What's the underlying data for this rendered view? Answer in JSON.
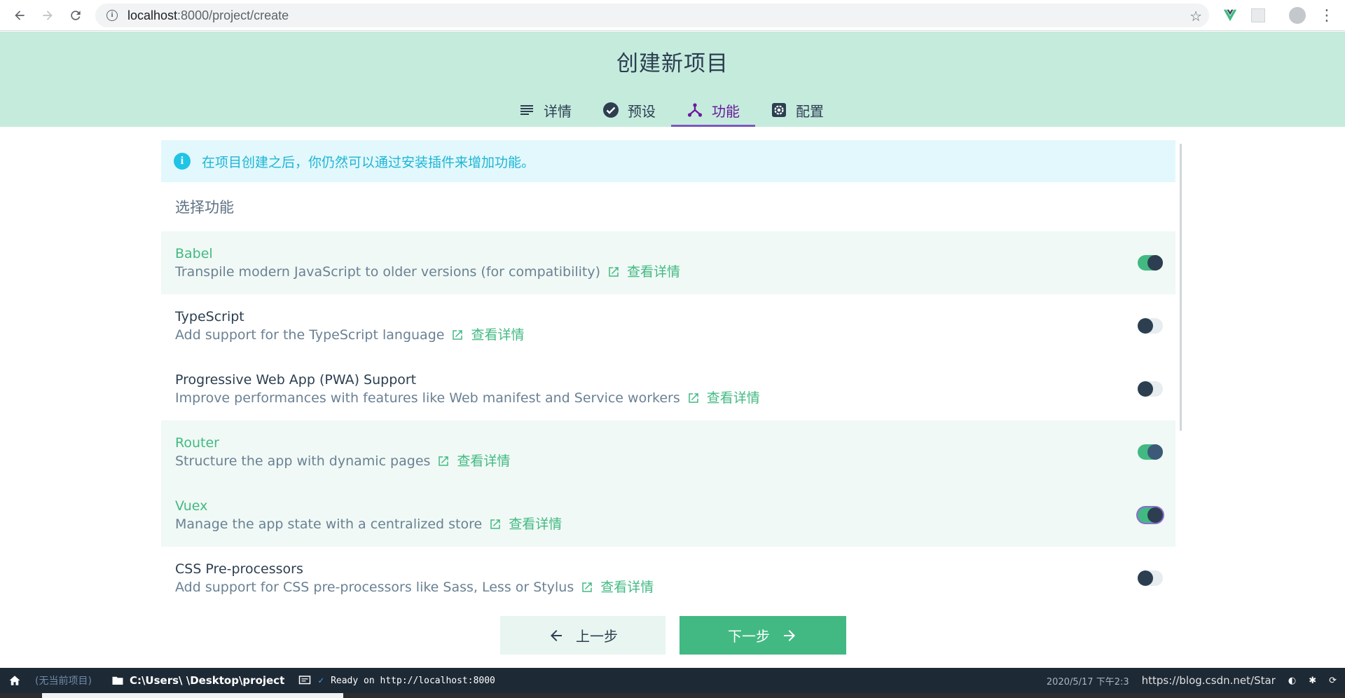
{
  "browser": {
    "url_host": "localhost",
    "url_path": ":8000/project/create"
  },
  "header": {
    "title": "创建新项目",
    "tabs": [
      {
        "label": "详情",
        "icon": "list-icon"
      },
      {
        "label": "预设",
        "icon": "check-circle-icon"
      },
      {
        "label": "功能",
        "icon": "fork-icon",
        "active": true
      },
      {
        "label": "配置",
        "icon": "gear-icon"
      }
    ]
  },
  "main": {
    "tip": "在项目创建之后，你仍然可以通过安装插件来增加功能。",
    "section_title": "选择功能",
    "link_label": "查看详情",
    "features": [
      {
        "name": "Babel",
        "desc": "Transpile modern JavaScript to older versions (for compatibility)",
        "enabled": true
      },
      {
        "name": "TypeScript",
        "desc": "Add support for the TypeScript language",
        "enabled": false
      },
      {
        "name": "Progressive Web App (PWA) Support",
        "desc": "Improve performances with features like Web manifest and Service workers",
        "enabled": false
      },
      {
        "name": "Router",
        "desc": "Structure the app with dynamic pages",
        "enabled": true
      },
      {
        "name": "Vuex",
        "desc": "Manage the app state with a centralized store",
        "enabled": true
      },
      {
        "name": "CSS Pre-processors",
        "desc": "Add support for CSS pre-processors like Sass, Less or Stylus",
        "enabled": false
      }
    ]
  },
  "buttons": {
    "prev": "上一步",
    "next": "下一步"
  },
  "status": {
    "project": "(无当前项目)",
    "folder": "C:\\Users\\    \\Desktop\\project",
    "log": "Ready on http://localhost:8000",
    "datetime": "2020/5/17  下午2:3",
    "watermark": "https://blog.csdn.net/Star"
  },
  "colors": {
    "header_bg": "#c5ebdd",
    "accent": "#42b983",
    "active_tab": "#6a1b9a",
    "tip_text": "#1eb5d6"
  }
}
